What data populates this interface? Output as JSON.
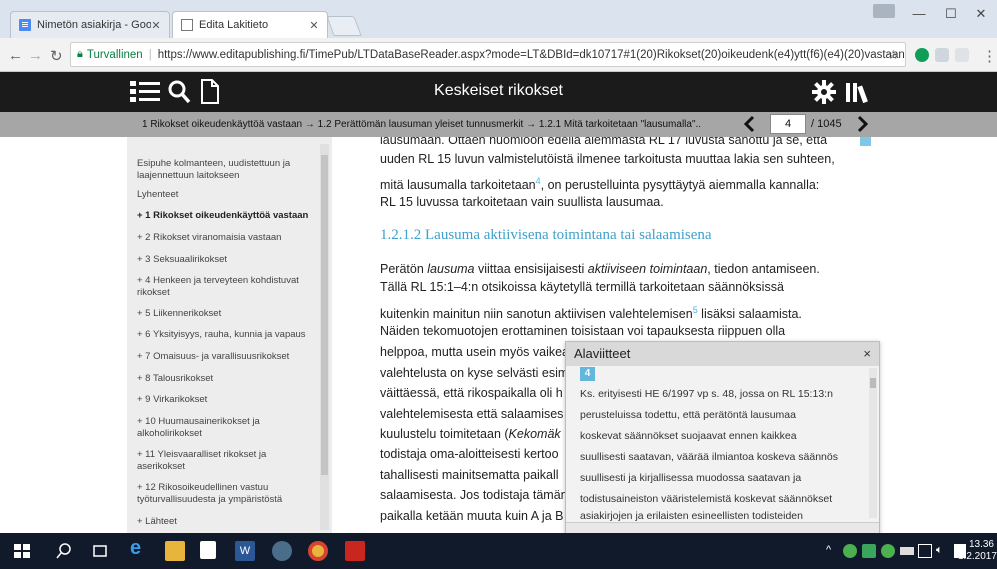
{
  "browser": {
    "tabs": [
      {
        "label": "Nimetön asiakirja - Goog",
        "active": false
      },
      {
        "label": "Edita Lakitieto",
        "active": true
      }
    ],
    "security_label": "Turvallinen",
    "url": "https://www.editapublishing.fi/TimePub/LTDataBaseReader.aspx?mode=LT&DBId=dk10717#1(20)Rikokset(20)oikeudenk(e4)ytt(f6)(e4)(20)vastaan:"
  },
  "app": {
    "title": "Keskeiset rikokset"
  },
  "breadcrumb": {
    "text": "1 Rikokset oikeudenkäyttöä vastaan → 1.2 Perättömän lausuman yleiset tunnusmerkit → 1.2.1 Mitä tarkoitetaan \"lausumalla\"..",
    "current_page": "4",
    "total_pages": "/ 1045"
  },
  "toc": [
    {
      "label": "Esipuhe kolmanteen, uudistettuun ja laajennettuun laitokseen",
      "bold": false
    },
    {
      "label": "Lyhenteet",
      "bold": false
    },
    {
      "label": "+ 1 Rikokset oikeudenkäyttöä vastaan",
      "bold": true
    },
    {
      "label": "+ 2 Rikokset viranomaisia vastaan",
      "bold": false
    },
    {
      "label": "+ 3 Seksuaalirikokset",
      "bold": false
    },
    {
      "label": "+ 4 Henkeen ja terveyteen kohdistuvat rikokset",
      "bold": false
    },
    {
      "label": "+ 5 Liikennerikokset",
      "bold": false
    },
    {
      "label": "+ 6 Yksityisyys, rauha, kunnia ja vapaus",
      "bold": false
    },
    {
      "label": "+ 7 Omaisuus- ja varallisuusrikokset",
      "bold": false
    },
    {
      "label": "+ 8 Talousrikokset",
      "bold": false
    },
    {
      "label": "+ 9 Virkarikokset",
      "bold": false
    },
    {
      "label": "+ 10 Huumausainerikokset ja alkoholirikokset",
      "bold": false
    },
    {
      "label": "+ 11 Yleisvaaralliset rikokset ja aserikokset",
      "bold": false
    },
    {
      "label": "+ 12 Rikosoikeudellinen vastuu työturvallisuudesta ja ympäristöstä",
      "bold": false
    },
    {
      "label": "+ Lähteet",
      "bold": false
    }
  ],
  "content": {
    "lines_top": [
      "lausumaan. Ottaen huomioon edellä aiemmasta RL 17 luvusta sanottu ja se, että",
      "uuden RL 15 luvun valmistelutöistä ilmenee tarkoitusta muuttaa lakia sen suhteen,",
      "mitä lausumalla tarkoitetaan",
      ", on perustelluinta pysyttäytyä aiemmalla kannalla:",
      "RL 15 luvussa tarkoitetaan vain suullista lausumaa."
    ],
    "footnote_ref_1": "4",
    "heading": "1.2.1.2 Lausuma aktiivisena toimintana tai salaamisena",
    "para2": [
      "Perätön ",
      "lausuma",
      " viittaa ensisijaisesti ",
      "aktiiviseen toimintaan",
      ", tiedon antamiseen.",
      "Tällä RL 15:1–4:n otsikoissa käytetyllä termillä tarkoitetaan säännöksissä",
      "kuitenkin mainitun niin sanotun aktiivisen valehtelemisen",
      " lisäksi salaamista.",
      "Näiden tekomuotojen erottaminen toisistaan voi tapauksesta riippuen olla",
      "helppoa, mutta usein myös vaikea",
      "valehtelusta on kyse selvästi esim",
      "väittäessä, että rikospaikalla oli h",
      "valehtelemisesta että salaamises",
      "kuulustelu toimitetaan (",
      "Kekomäk",
      "todistaja oma-aloitteisesti kertoo",
      "tahallisesti mainitsematta paikall",
      "salaamisesta. Jos todistaja tämän",
      "paikalla ketään muuta kuin A ja B"
    ],
    "footnote_ref_2": "5"
  },
  "footnote_popup": {
    "title": "Alaviitteet",
    "close": "×",
    "number": "4",
    "lines": [
      "Ks. erityisesti HE 6/1997 vp s. 48, jossa on RL 15:13:n",
      "perusteluissa todettu, että perätöntä lausumaa",
      "koskevat säännökset suojaavat ennen kaikkea",
      "suullisesti saatavan, väärää ilmiantoa koskeva säännös",
      "suullisesti ja kirjallisessa muodossa saatavan ja",
      "todistusaineiston vääristelemistä koskevat säännökset",
      "asiakirjojen ja erilaisten esineellisten todisteiden"
    ]
  },
  "taskbar": {
    "time": "13.36",
    "date": "1.2.2017"
  }
}
